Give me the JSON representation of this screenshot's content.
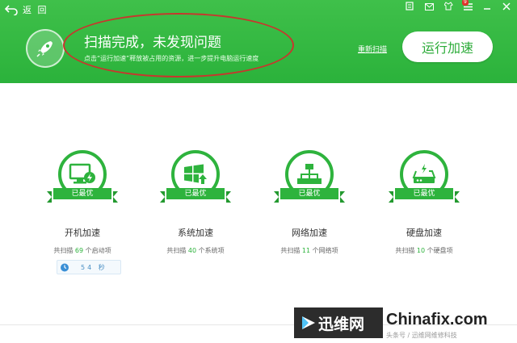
{
  "header": {
    "back_label": "返 回",
    "title": "扫描完成，未发现问题",
    "subtitle": "点击“运行加速”释放被占用的资源，进一步提升电脑运行速度",
    "rescan_label": "重新扫描",
    "run_button_label": "运行加速",
    "notification_count": "9"
  },
  "cards": [
    {
      "badge": "已最优",
      "title": "开机加速",
      "desc_prefix": "共扫描",
      "count": "69",
      "desc_suffix": "个启动项"
    },
    {
      "badge": "已最优",
      "title": "系统加速",
      "desc_prefix": "共扫描",
      "count": "40",
      "desc_suffix": "个系统项"
    },
    {
      "badge": "已最优",
      "title": "网络加速",
      "desc_prefix": "共扫描",
      "count": "11",
      "desc_suffix": "个网络项"
    },
    {
      "badge": "已最优",
      "title": "硬盘加速",
      "desc_prefix": "共扫描",
      "count": "10",
      "desc_suffix": "个硬盘项"
    }
  ],
  "boot_timer": {
    "value": "54",
    "unit": "秒"
  },
  "watermark": {
    "cn": "迅维网",
    "en": "Chinafix.com",
    "toutiao": "头条号 / 迅维网维修科技"
  },
  "colors": {
    "brand_green": "#2bb23b",
    "annotation_red": "#c8362d"
  }
}
